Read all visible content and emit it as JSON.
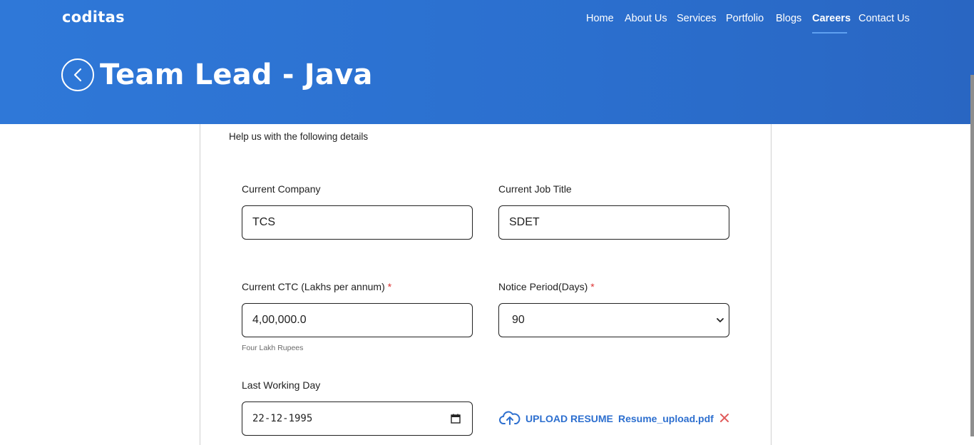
{
  "brand": {
    "logo": "coditas"
  },
  "nav": {
    "items": [
      {
        "label": "Home"
      },
      {
        "label": "About Us"
      },
      {
        "label": "Services"
      },
      {
        "label": "Portfolio"
      },
      {
        "label": "Blogs"
      },
      {
        "label": "Careers",
        "active": true
      },
      {
        "label": "Contact Us"
      }
    ]
  },
  "page": {
    "title": "Team Lead - Java"
  },
  "form": {
    "intro": "Help us with the following details",
    "current_company": {
      "label": "Current Company",
      "value": "TCS"
    },
    "current_job_title": {
      "label": "Current Job Title",
      "value": "SDET"
    },
    "current_ctc": {
      "label": "Current CTC (Lakhs per annum)",
      "required_mark": "*",
      "value": "4,00,000.0",
      "hint": "Four Lakh Rupees"
    },
    "notice_period": {
      "label": "Notice Period(Days)",
      "required_mark": "*",
      "value": "90"
    },
    "last_working_day": {
      "label": "Last Working Day",
      "value": "22-12-1995"
    },
    "resume": {
      "upload_label": "UPLOAD RESUME",
      "file_name": "Resume_upload.pdf"
    }
  },
  "colors": {
    "header_blue": "#2f78d8",
    "link_blue": "#2d6fcf",
    "required_red": "#dd3333",
    "remove_red": "#e05a5a"
  }
}
